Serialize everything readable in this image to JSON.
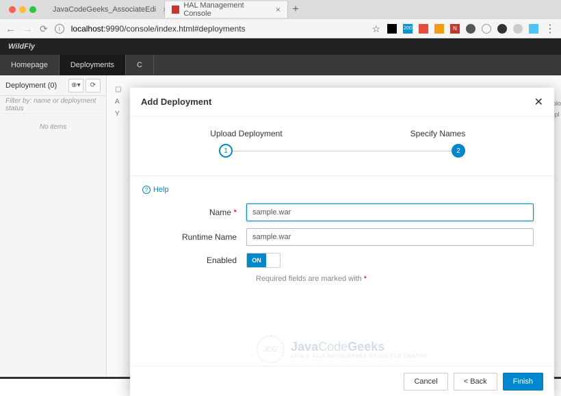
{
  "browser": {
    "tabs": [
      {
        "title": "JavaCodeGeeks_AssociateEdi"
      },
      {
        "title": "HAL Management Console"
      }
    ],
    "url_host": "localhost",
    "url_path": ":9990/console/index.html#deployments"
  },
  "app": {
    "brand": "WildFly",
    "nav": [
      "Homepage",
      "Deployments",
      "C"
    ]
  },
  "sidebar": {
    "title": "Deployment (0)",
    "filter_placeholder": "Filter by: name or deployment status",
    "empty": "No items"
  },
  "content": {
    "line1": "A",
    "line2": "Y"
  },
  "bgtext": {
    "t1": "eplo",
    "t2": "tepl"
  },
  "modal": {
    "title": "Add Deployment",
    "step1": "Upload Deployment",
    "step2": "Specify Names",
    "step1_num": "1",
    "step2_num": "2",
    "help": "Help",
    "name_label": "Name",
    "name_value": "sample.war",
    "runtime_label": "Runtime Name",
    "runtime_value": "sample.war",
    "enabled_label": "Enabled",
    "toggle_on": "ON",
    "required_note": "Required fields are marked with ",
    "cancel": "Cancel",
    "back": "< Back",
    "finish": "Finish"
  },
  "watermark": {
    "logo": "JCG",
    "text1": "Java",
    "text2": "Code",
    "text3": "Geeks",
    "sub": "JAVA 2 JAVA DEVELOPERS RESOURCE CENTER"
  }
}
